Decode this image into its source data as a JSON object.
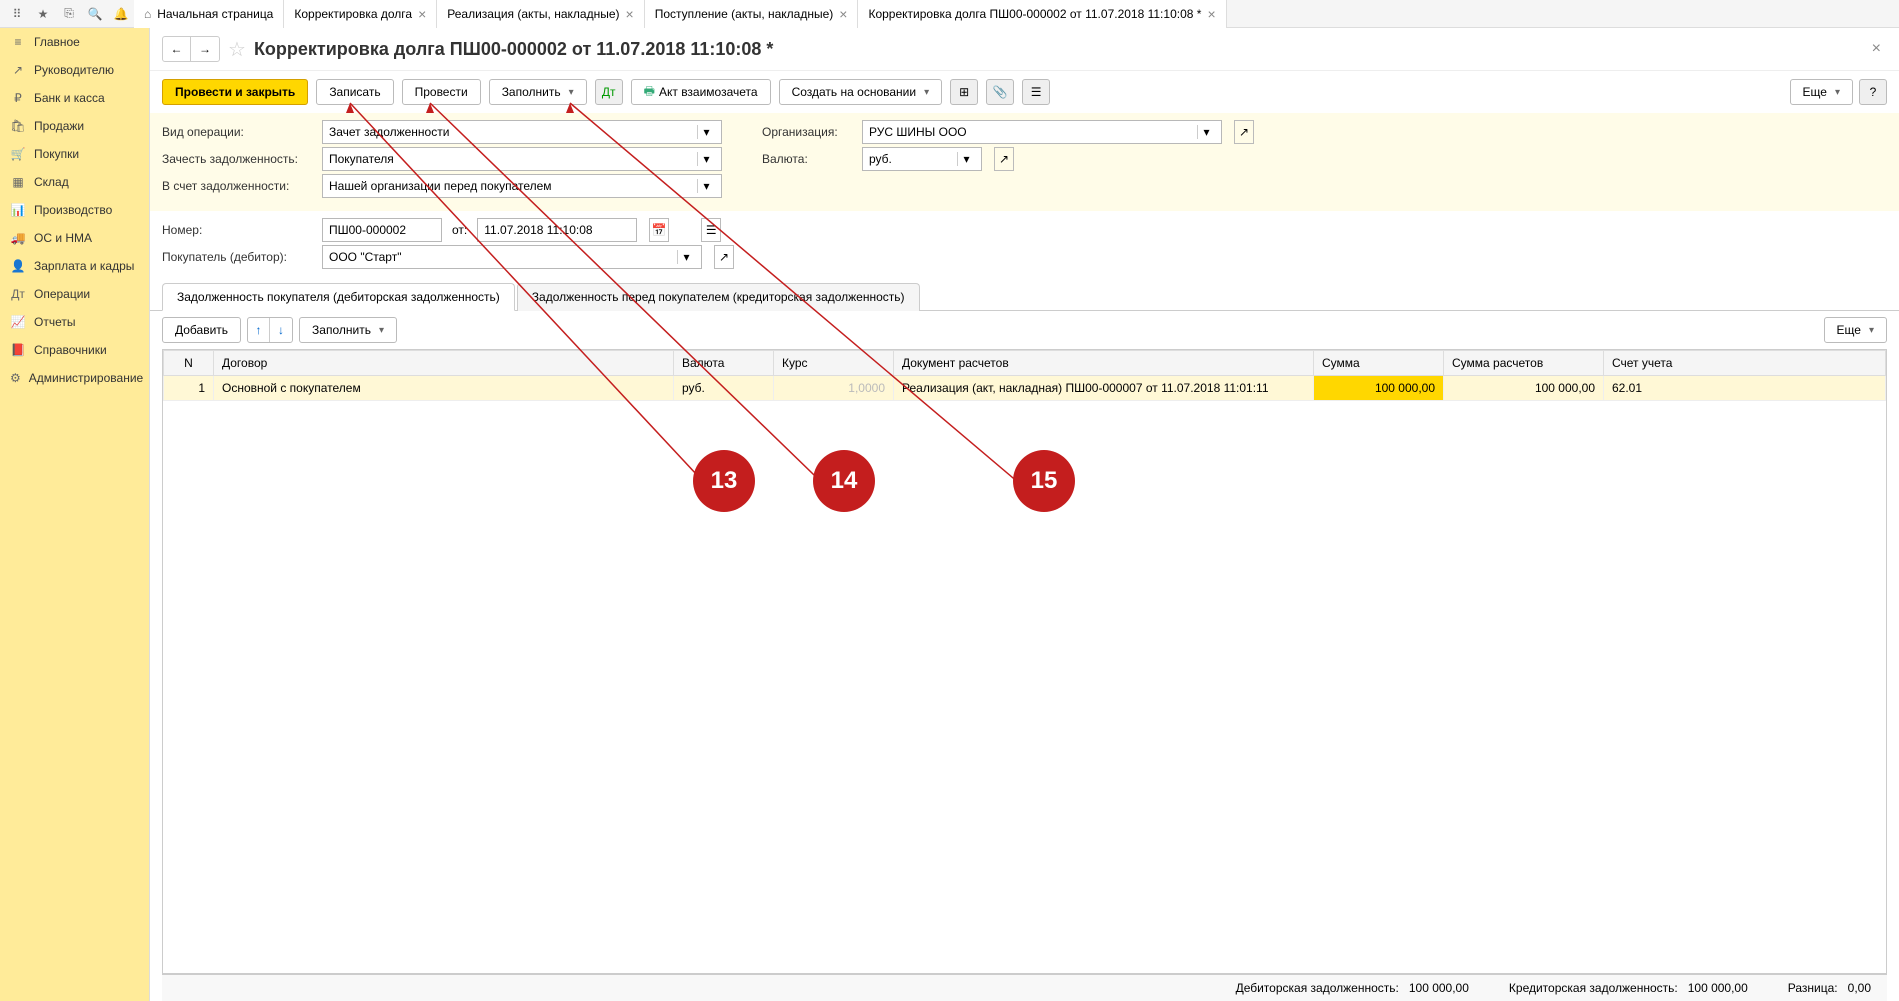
{
  "tabs": [
    {
      "label": "Начальная страница",
      "closable": false,
      "home": true
    },
    {
      "label": "Корректировка долга",
      "closable": true
    },
    {
      "label": "Реализация (акты, накладные)",
      "closable": true
    },
    {
      "label": "Поступление (акты, накладные)",
      "closable": true
    },
    {
      "label": "Корректировка долга ПШ00-000002 от 11.07.2018 11:10:08 *",
      "closable": true,
      "active": true
    }
  ],
  "sidebar": [
    {
      "icon": "≡",
      "label": "Главное"
    },
    {
      "icon": "↗",
      "label": "Руководителю"
    },
    {
      "icon": "₽",
      "label": "Банк и касса"
    },
    {
      "icon": "🛍",
      "label": "Продажи"
    },
    {
      "icon": "🛒",
      "label": "Покупки"
    },
    {
      "icon": "▦",
      "label": "Склад"
    },
    {
      "icon": "📊",
      "label": "Производство"
    },
    {
      "icon": "🚚",
      "label": "ОС и НМА"
    },
    {
      "icon": "👤",
      "label": "Зарплата и кадры"
    },
    {
      "icon": "Дт",
      "label": "Операции"
    },
    {
      "icon": "📈",
      "label": "Отчеты"
    },
    {
      "icon": "📕",
      "label": "Справочники"
    },
    {
      "icon": "⚙",
      "label": "Администрирование"
    }
  ],
  "page_title": "Корректировка долга ПШ00-000002 от 11.07.2018 11:10:08 *",
  "toolbar": {
    "post_close": "Провести и закрыть",
    "save": "Записать",
    "post": "Провести",
    "fill": "Заполнить",
    "act": "Акт взаимозачета",
    "create_based": "Создать на основании",
    "more": "Еще",
    "help": "?"
  },
  "form": {
    "op_type_label": "Вид операции:",
    "op_type_value": "Зачет задолженности",
    "offset_label": "Зачесть задолженность:",
    "offset_value": "Покупателя",
    "against_label": "В счет задолженности:",
    "against_value": "Нашей организации перед покупателем",
    "org_label": "Организация:",
    "org_value": "РУС ШИНЫ ООО",
    "currency_label": "Валюта:",
    "currency_value": "руб.",
    "number_label": "Номер:",
    "number_value": "ПШ00-000002",
    "date_label": "от:",
    "date_value": "11.07.2018 11:10:08",
    "buyer_label": "Покупатель (дебитор):",
    "buyer_value": "ООО \"Старт\""
  },
  "doc_tabs": {
    "tab1": "Задолженность покупателя (дебиторская задолженность)",
    "tab2": "Задолженность перед покупателем (кредиторская задолженность)"
  },
  "table_toolbar": {
    "add": "Добавить",
    "fill": "Заполнить",
    "more": "Еще"
  },
  "table": {
    "headers": {
      "n": "N",
      "contract": "Договор",
      "currency": "Валюта",
      "rate": "Курс",
      "doc": "Документ расчетов",
      "amount": "Сумма",
      "calc_amount": "Сумма расчетов",
      "account": "Счет учета"
    },
    "rows": [
      {
        "n": "1",
        "contract": "Основной с покупателем",
        "currency": "руб.",
        "rate": "1,0000",
        "doc": "Реализация (акт, накладная) ПШ00-000007 от 11.07.2018 11:01:11",
        "amount": "100 000,00",
        "calc_amount": "100 000,00",
        "account": "62.01"
      }
    ]
  },
  "status": {
    "debit_label": "Дебиторская задолженность:",
    "debit_value": "100 000,00",
    "credit_label": "Кредиторская задолженность:",
    "credit_value": "100 000,00",
    "diff_label": "Разница:",
    "diff_value": "0,00"
  },
  "markers": {
    "m13": "13",
    "m14": "14",
    "m15": "15"
  }
}
